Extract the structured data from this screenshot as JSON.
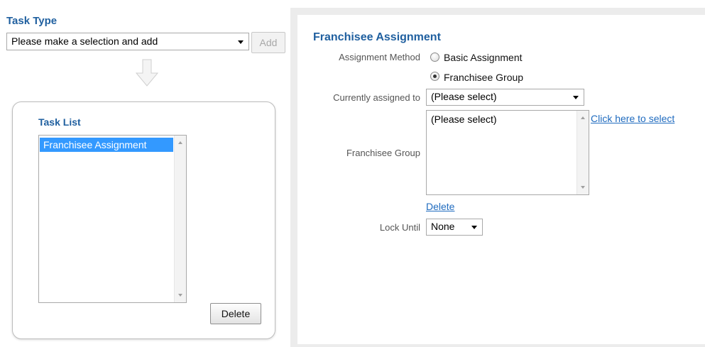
{
  "task_type": {
    "heading": "Task Type",
    "select_value": "Please make a selection and add",
    "add_label": "Add"
  },
  "task_list": {
    "heading": "Task List",
    "items": [
      "Franchisee Assignment"
    ],
    "selected_color": "#3399ff",
    "delete_label": "Delete"
  },
  "assignment": {
    "heading": "Franchisee Assignment",
    "method_label": "Assignment Method",
    "method_options": [
      {
        "label": "Basic Assignment",
        "checked": false
      },
      {
        "label": "Franchisee Group",
        "checked": true
      }
    ],
    "currently_assigned_label": "Currently assigned to",
    "currently_assigned_value": "(Please select)",
    "group_label": "Franchisee Group",
    "group_items": [
      "(Please select)"
    ],
    "select_link": "Click here to select",
    "delete_link": "Delete",
    "lock_label": "Lock Until",
    "lock_value": "None"
  },
  "colors": {
    "heading": "#1f5f9f",
    "link": "#1f6bbf",
    "panel_border": "#ececec"
  }
}
